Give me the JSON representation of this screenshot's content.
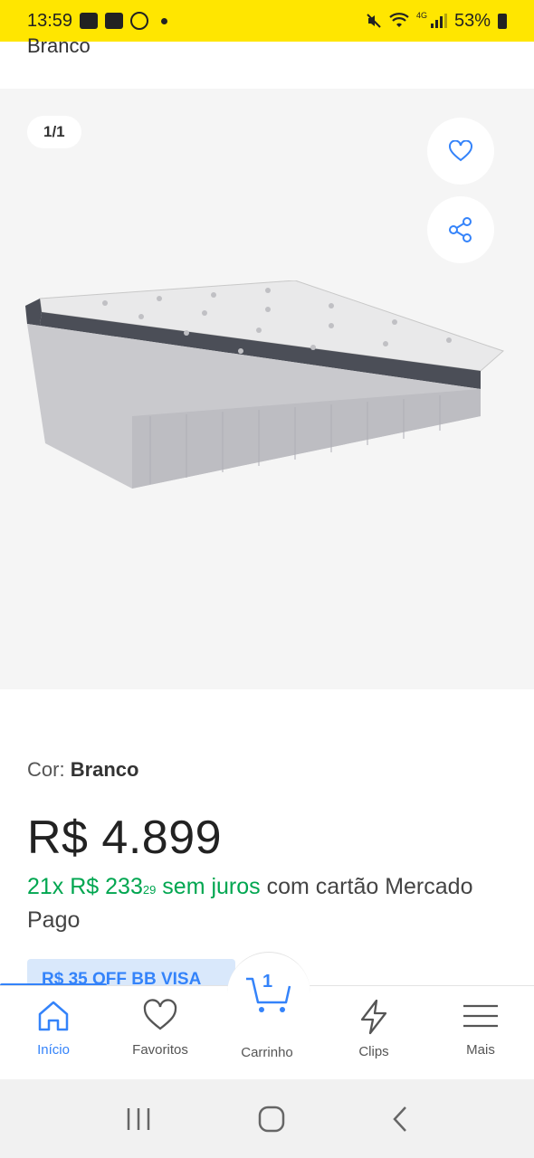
{
  "status_bar": {
    "time": "13:59",
    "battery": "53%",
    "network": "4G"
  },
  "product": {
    "title_fragment": "Branco",
    "gallery_counter": "1/1",
    "color_label": "Cor:",
    "color_value": "Branco",
    "price": "R$ 4.899",
    "installments": {
      "count_value": "21x R$ 233",
      "cents": "29",
      "no_interest": " sem juros",
      "rest": " com cartão Mercado Pago"
    },
    "promo_badge": "R$ 35 OFF BB VISA"
  },
  "bottom_nav": {
    "items": [
      {
        "label": "Início",
        "icon": "home-icon"
      },
      {
        "label": "Favoritos",
        "icon": "heart-icon"
      },
      {
        "label": "Carrinho",
        "icon": "cart-icon"
      },
      {
        "label": "Clips",
        "icon": "lightning-icon"
      },
      {
        "label": "Mais",
        "icon": "menu-icon"
      }
    ],
    "cart_count": "1"
  },
  "colors": {
    "accent": "#3483fa",
    "green": "#00a650",
    "status_bar": "#ffe600"
  }
}
